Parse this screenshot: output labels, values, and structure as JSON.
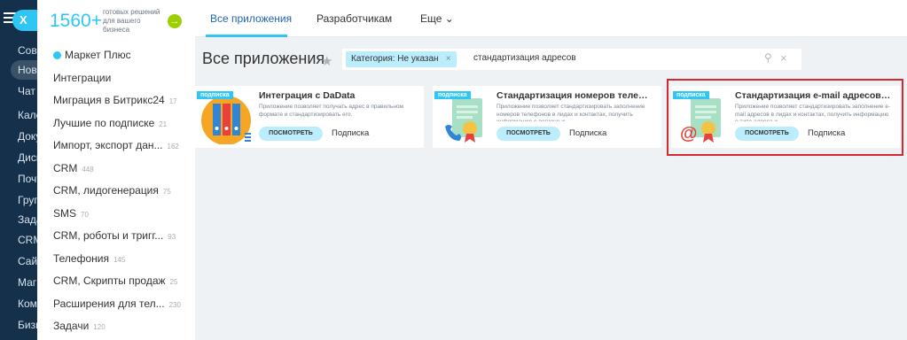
{
  "leftnav": {
    "logo_label": "X",
    "items": [
      {
        "label": "Сове",
        "active": false
      },
      {
        "label": "Ново",
        "active": true
      },
      {
        "label": "Чат",
        "active": false
      },
      {
        "label": "Кале",
        "active": false
      },
      {
        "label": "Доку",
        "active": false
      },
      {
        "label": "Диск",
        "active": false
      },
      {
        "label": "Почт",
        "active": false
      },
      {
        "label": "Груп",
        "active": false
      },
      {
        "label": "Зада",
        "active": false
      },
      {
        "label": "CRM",
        "active": false
      },
      {
        "label": "Сайт",
        "active": false
      },
      {
        "label": "Маг",
        "active": false
      },
      {
        "label": "Ком",
        "active": false
      },
      {
        "label": "Бизн",
        "active": false
      }
    ]
  },
  "catalog": {
    "count": "1560+",
    "subtitle": "готовых решений для вашего бизнеса",
    "items": [
      {
        "label": "Маркет Плюс",
        "count": ""
      },
      {
        "label": "Интеграции",
        "count": ""
      },
      {
        "label": "Миграция в Битрикс24",
        "count": "17"
      },
      {
        "label": "Лучшие по подписке",
        "count": "21"
      },
      {
        "label": "Импорт, экспорт дан...",
        "count": "162"
      },
      {
        "label": "CRM",
        "count": "448"
      },
      {
        "label": "CRM, лидогенерация",
        "count": "75"
      },
      {
        "label": "SMS",
        "count": "70"
      },
      {
        "label": "CRM, роботы и тригг...",
        "count": "93"
      },
      {
        "label": "Телефония",
        "count": "145"
      },
      {
        "label": "CRM, Скрипты продаж",
        "count": "25"
      },
      {
        "label": "Расширения для тел...",
        "count": "230"
      },
      {
        "label": "Задачи",
        "count": "120"
      }
    ]
  },
  "tabs": [
    {
      "label": "Все приложения",
      "active": true
    },
    {
      "label": "Разработчикам",
      "active": false
    },
    {
      "label": "Еще ⌄",
      "active": false
    }
  ],
  "page": {
    "title": "Все приложения"
  },
  "search": {
    "filter_tag": "Категория: Не указан",
    "query": "стандартизация адресов"
  },
  "cards": [
    {
      "badge": "подписка",
      "title": "Интеграция с DaData",
      "desc": "Приложение позволяет получать адрес в правильном формате и стандартизировать его.",
      "button": "ПОСМОТРЕТЬ",
      "sub": "Подписка",
      "icon": "folders-icon"
    },
    {
      "badge": "подписка",
      "title": "Стандартизация номеров телефо...",
      "desc": "Приложение позволяет стандартизировать заполнение номеров телефонов в лидах и контактах, получить информацию о регионе и",
      "button": "ПОСМОТРЕТЬ",
      "sub": "Подписка",
      "icon": "phone-document-icon"
    },
    {
      "badge": "подписка",
      "title": "Стандартизация e-mail адресов (D...",
      "desc": "Приложение позволяет стандартизировать заполнение e-mail адресов в лидах и контактах, получить информацию о типе адреса и",
      "button": "ПОСМОТРЕТЬ",
      "sub": "Подписка",
      "icon": "email-document-icon"
    }
  ],
  "colors": {
    "accent": "#2fc6f6",
    "nav_bg": "#15304a",
    "highlight": "#d42a2e",
    "button_bg": "#bcedfc"
  }
}
